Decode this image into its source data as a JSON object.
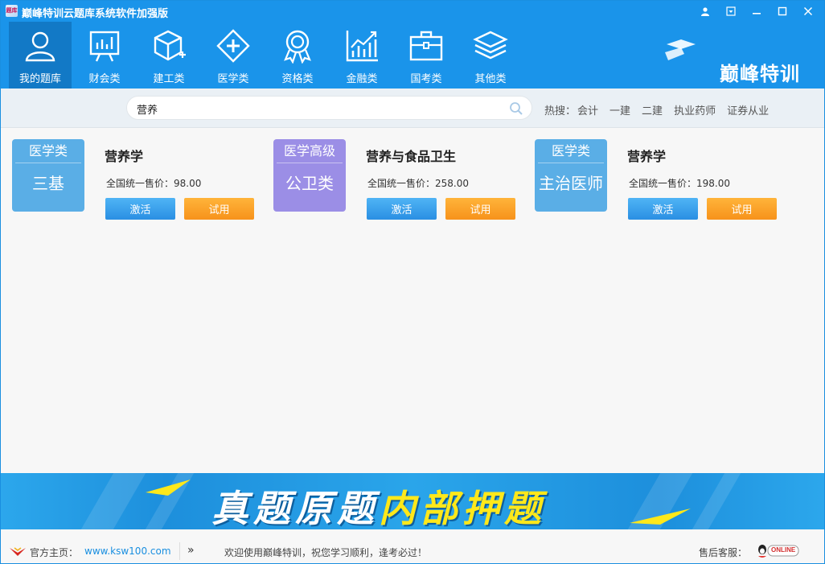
{
  "window": {
    "title": "巅峰特训云题库系统软件加强版",
    "app_icon_text": "题库"
  },
  "nav": {
    "items": [
      {
        "label": "我的题库",
        "icon": "user-icon",
        "active": true
      },
      {
        "label": "财会类",
        "icon": "chart-board-icon",
        "active": false
      },
      {
        "label": "建工类",
        "icon": "cube-icon",
        "active": false
      },
      {
        "label": "医学类",
        "icon": "medical-plus-icon",
        "active": false
      },
      {
        "label": "资格类",
        "icon": "medal-icon",
        "active": false
      },
      {
        "label": "金融类",
        "icon": "trend-chart-icon",
        "active": false
      },
      {
        "label": "国考类",
        "icon": "briefcase-icon",
        "active": false
      },
      {
        "label": "其他类",
        "icon": "layers-icon",
        "active": false
      }
    ],
    "brand": "巅峰特训"
  },
  "search": {
    "value": "营养",
    "hot_label": "热搜：",
    "hot_items": [
      "会计",
      "一建",
      "二建",
      "执业药师",
      "证券从业"
    ]
  },
  "products": [
    {
      "badge_top": "医学类",
      "badge_main": "三基",
      "badge_color": "#5aaee6",
      "title": "营养学",
      "price": "全国统一售价：98.00",
      "activate": "激活",
      "trial": "试用"
    },
    {
      "badge_top": "医学高级",
      "badge_main": "公卫类",
      "badge_color": "#9b8ee6",
      "title": "营养与食品卫生",
      "price": "全国统一售价：258.00",
      "activate": "激活",
      "trial": "试用"
    },
    {
      "badge_top": "医学类",
      "badge_main": "主治医师",
      "badge_color": "#5aaee6",
      "title": "营养学",
      "price": "全国统一售价：198.00",
      "activate": "激活",
      "trial": "试用"
    }
  ],
  "banner": {
    "white_text": "真题原题",
    "yellow_text": "内部押题"
  },
  "footer": {
    "home_label": "官方主页：",
    "home_link": "www.ksw100.com",
    "welcome": "欢迎使用巅峰特训，祝您学习顺利，逢考必过！",
    "service_label": "售后客服：",
    "online_badge": "ONLINE"
  },
  "colors": {
    "primary": "#1a94ea",
    "active_nav": "#1279c6",
    "activate_btn": "#2a8fe3",
    "trial_btn": "#f7921b"
  }
}
